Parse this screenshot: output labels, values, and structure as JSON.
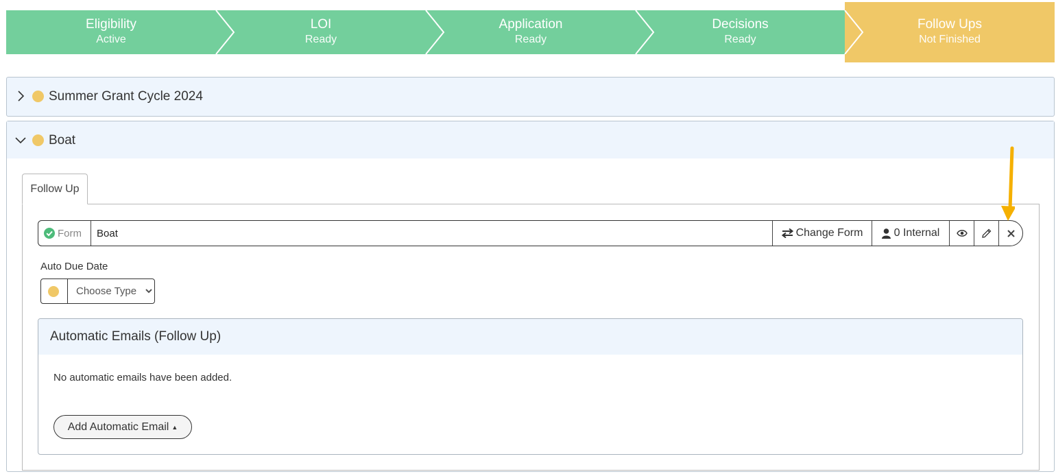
{
  "steps": [
    {
      "title": "Eligibility",
      "status": "Active"
    },
    {
      "title": "LOI",
      "status": "Ready"
    },
    {
      "title": "Application",
      "status": "Ready"
    },
    {
      "title": "Decisions",
      "status": "Ready"
    },
    {
      "title": "Follow Ups",
      "status": "Not Finished"
    }
  ],
  "colors": {
    "step_green": "#73cf9c",
    "step_active": "#f0c867",
    "status_dot": "#f0c867",
    "panel_bg": "#eef5fd",
    "arrow": "#f5b000"
  },
  "panels": [
    {
      "caret_icon": "chevron-right-icon",
      "title": "Summer Grant Cycle 2024"
    },
    {
      "caret_icon": "chevron-down-icon",
      "title": "Boat"
    }
  ],
  "tab": {
    "label": "Follow Up"
  },
  "form_row": {
    "label": "Form",
    "name": "Boat",
    "change_form_label": "Change Form",
    "internal_label": "0 Internal",
    "icons": [
      "check-circle-icon",
      "swap-icon",
      "user-icon",
      "eye-icon",
      "pencil-icon",
      "close-icon"
    ]
  },
  "auto_due": {
    "label": "Auto Due Date",
    "select_value": "Choose Type"
  },
  "emails_card": {
    "title": "Automatic Emails (Follow Up)",
    "empty_text": "No automatic emails have been added.",
    "add_button": "Add Automatic Email"
  }
}
